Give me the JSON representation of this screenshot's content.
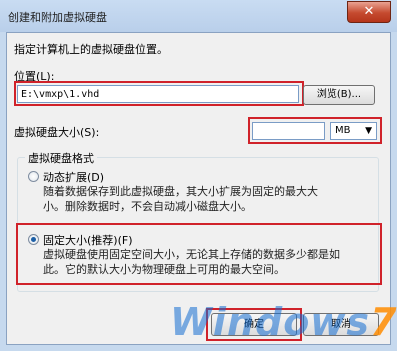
{
  "window": {
    "title": "创建和附加虚拟硬盘",
    "close_glyph": "✕"
  },
  "instruction": "指定计算机上的虚拟硬盘位置。",
  "location": {
    "label": "位置(L):",
    "value": "E:\\vmxp\\1.vhd",
    "browse_label": "浏览(B)..."
  },
  "size": {
    "label": "虚拟硬盘大小(S):",
    "value": "",
    "unit": "MB"
  },
  "format": {
    "group_label": "虚拟硬盘格式",
    "options": [
      {
        "label": "动态扩展(D)",
        "desc1": "随着数据保存到此虚拟硬盘，其大小扩展为固定的最大大",
        "desc2": "小。删除数据时，不会自动减小磁盘大小。",
        "selected": false
      },
      {
        "label": "固定大小(推荐)(F)",
        "desc1": "虚拟硬盘使用固定空间大小，无论其上存储的数据多少都是如",
        "desc2": "此。它的默认大小为物理硬盘上可用的最大空间。",
        "selected": true
      }
    ]
  },
  "footer": {
    "ok_label": "确定",
    "cancel_label": "取消"
  },
  "watermark": {
    "text": "Windows",
    "accent": "7"
  },
  "colors": {
    "highlight": "#d0222a",
    "accent": "#1d5fa6"
  }
}
